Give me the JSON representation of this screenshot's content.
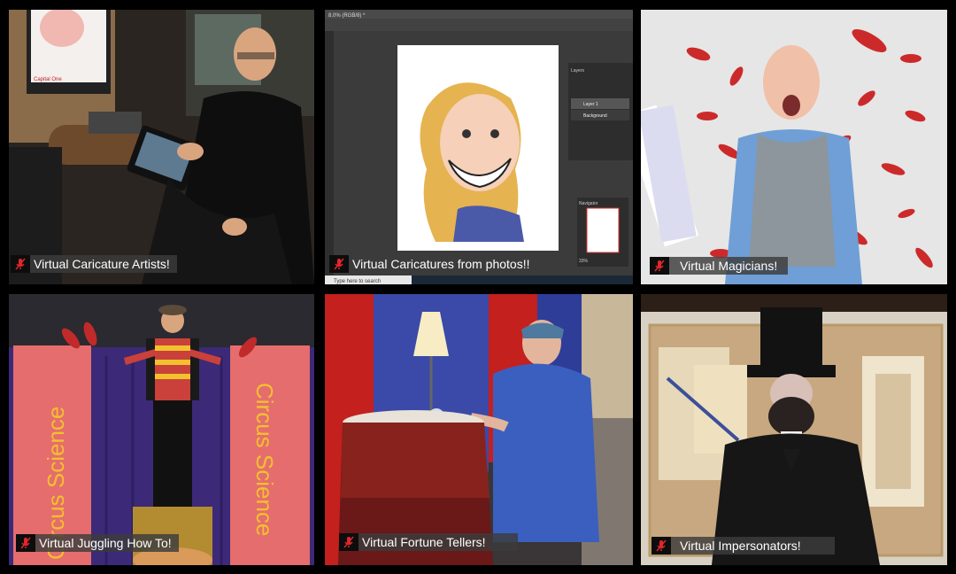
{
  "tiles": [
    {
      "id": "caricature-artists",
      "label": "Virtual Caricature Artists!",
      "screen_logo": "Capital One"
    },
    {
      "id": "caricatures-from-photos",
      "label": "Virtual Caricatures from photos!!",
      "app_title": "8.0% (RGB/8) *",
      "taskbar_search": "Type here to search",
      "panels": {
        "layers": "Layers",
        "navigator": "Navigator",
        "layer_names": [
          "Layer 1",
          "Background"
        ]
      },
      "zoom": "33%"
    },
    {
      "id": "magicians",
      "label": "Virtual Magicians!"
    },
    {
      "id": "juggling",
      "label": "Virtual Juggling How To!",
      "banner_text": "Circus Science"
    },
    {
      "id": "fortune-tellers",
      "label": "Virtual Fortune Tellers!"
    },
    {
      "id": "impersonators",
      "label": "Virtual Impersonators!"
    }
  ],
  "icons": {
    "label_icon": "muted-microphone-icon",
    "mic_color": "#e0262c"
  }
}
